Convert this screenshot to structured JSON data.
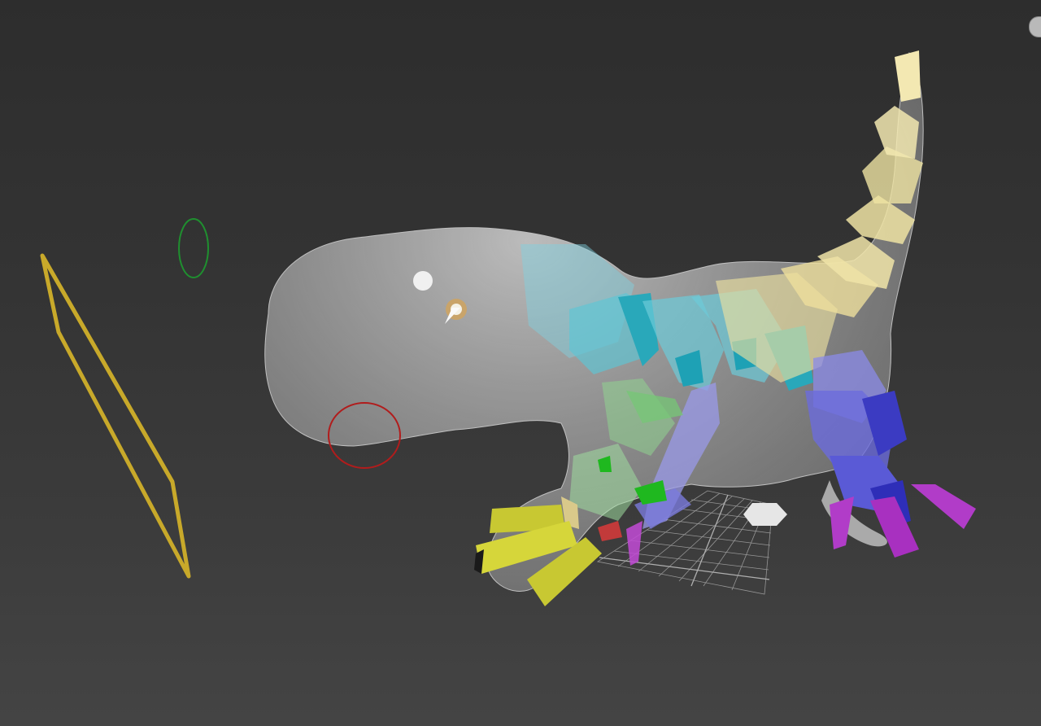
{
  "viewport": {
    "name": "perspective-viewport",
    "background_top": "#2d2d2d",
    "background_bottom": "#444444"
  },
  "scene": {
    "objects": [
      {
        "id": "camera-plane-helper",
        "color": "#c8a92a"
      },
      {
        "id": "ik-target-circle",
        "color": "#1f8f2f"
      },
      {
        "id": "jaw-control-circle",
        "color": "#b11c1c"
      },
      {
        "id": "dinosaur-mesh",
        "color": "#d6d6d6"
      },
      {
        "id": "spine-bones",
        "color": "#39b6c8"
      },
      {
        "id": "tail-bones",
        "color": "#e9dfa0"
      },
      {
        "id": "right-leg-bones",
        "color": "#5a5ad6"
      },
      {
        "id": "left-leg-bones",
        "color": "#72c772"
      },
      {
        "id": "foot-bones",
        "color": "#c8c832"
      },
      {
        "id": "toe-bones",
        "color": "#b13cc8"
      },
      {
        "id": "ground-grid",
        "color": "#bcbcbc"
      },
      {
        "id": "point-helper",
        "color": "#e6e6e6"
      }
    ]
  },
  "viewcube": {
    "icon": "viewcube-icon"
  }
}
